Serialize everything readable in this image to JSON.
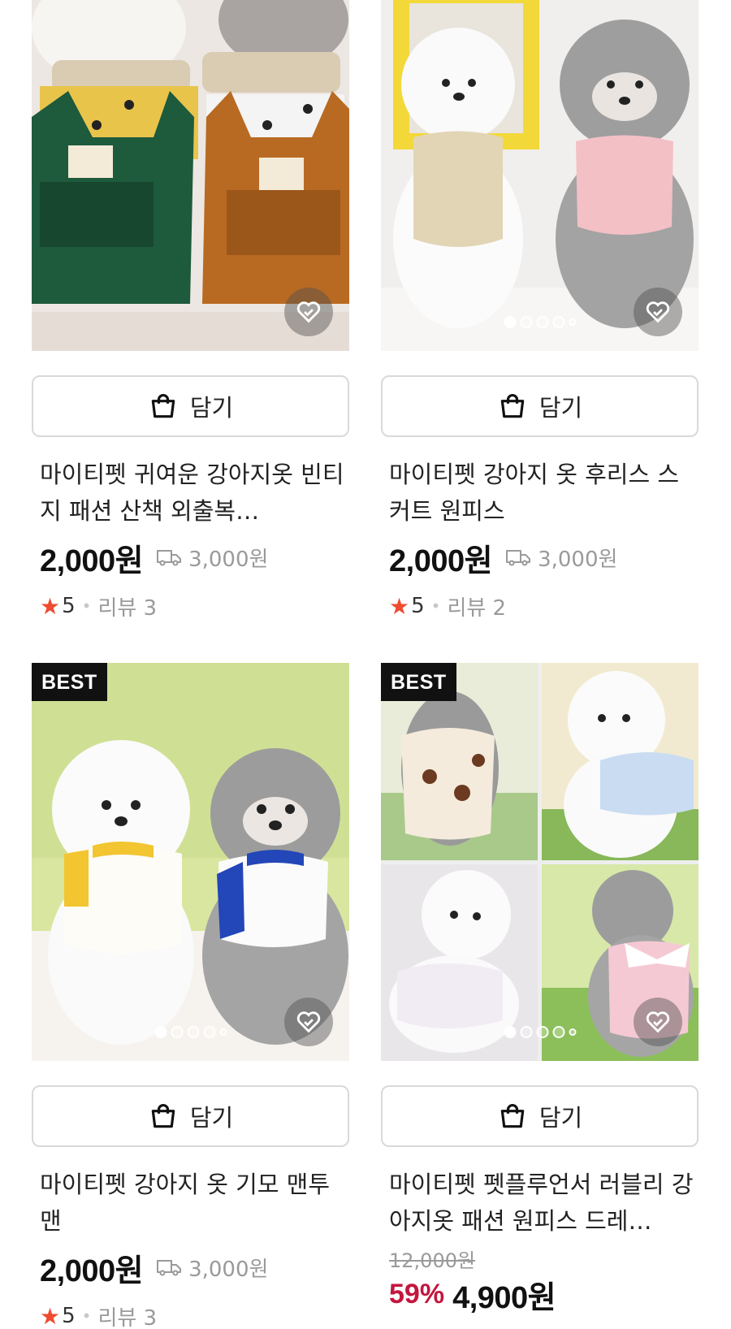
{
  "icons": {
    "cart": "shopping-bag-icon",
    "wish": "heart-icon",
    "shipping": "truck-icon",
    "star": "star-icon"
  },
  "colors": {
    "star": "#ef4b31",
    "discount": "#c4163d",
    "badge_bg": "#111111"
  },
  "products": [
    {
      "badge": "",
      "cart_label": "담기",
      "title": "마이티펫 귀여운 강아지옷 빈티지 패션 산책 외출복…",
      "price": "2,000원",
      "shipping": "3,000원",
      "rating": "5",
      "reviews": "리뷰 3"
    },
    {
      "badge": "",
      "cart_label": "담기",
      "title": "마이티펫 강아지 옷 후리스 스커트 원피스",
      "price": "2,000원",
      "shipping": "3,000원",
      "rating": "5",
      "reviews": "리뷰 2"
    },
    {
      "badge": "BEST",
      "cart_label": "담기",
      "title": "마이티펫 강아지 옷 기모 맨투맨",
      "price": "2,000원",
      "shipping": "3,000원",
      "rating": "5",
      "reviews": "리뷰 3"
    },
    {
      "badge": "BEST",
      "cart_label": "담기",
      "title": "마이티펫 펫플루언서 러블리 강아지옷 패션 원피스 드레…",
      "original_price": "12,000원",
      "discount": "59%",
      "price": "4,900원"
    }
  ]
}
